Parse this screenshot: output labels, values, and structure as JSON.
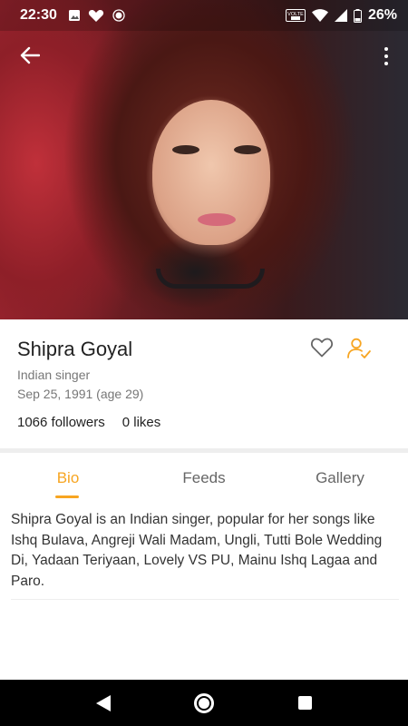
{
  "status_bar": {
    "time": "22:30",
    "battery_percent": "26%",
    "left_icons": [
      "image-icon",
      "heart-icon",
      "location-icon"
    ],
    "right_icons": [
      "volte-icon",
      "wifi-icon",
      "signal-icon",
      "battery-icon"
    ]
  },
  "header": {
    "back_icon": "arrow-left-icon",
    "menu_icon": "more-vertical-icon"
  },
  "profile": {
    "name": "Shipra Goyal",
    "subtitle": "Indian singer",
    "birth": "Sep 25, 1991 (age 29)",
    "followers": "1066 followers",
    "likes": "0 likes",
    "actions": [
      "heart-outline-icon",
      "user-follow-icon"
    ]
  },
  "tabs": [
    {
      "label": "Bio",
      "active": true
    },
    {
      "label": "Feeds",
      "active": false
    },
    {
      "label": "Gallery",
      "active": false
    }
  ],
  "bio": {
    "text": "Shipra Goyal is an Indian singer, popular for her songs like Ishq Bulava, Angreji Wali Madam, Ungli, Tutti Bole Wedding Di, Yadaan Teriyaan, Lovely VS PU, Mainu Ishq Lagaa and Paro."
  },
  "nav_bar": {
    "icons": [
      "back-triangle-icon",
      "home-circle-icon",
      "recents-square-icon"
    ]
  },
  "colors": {
    "accent": "#f7a521",
    "text_primary": "#222222",
    "text_secondary": "#777777",
    "navbar": "#000000"
  }
}
